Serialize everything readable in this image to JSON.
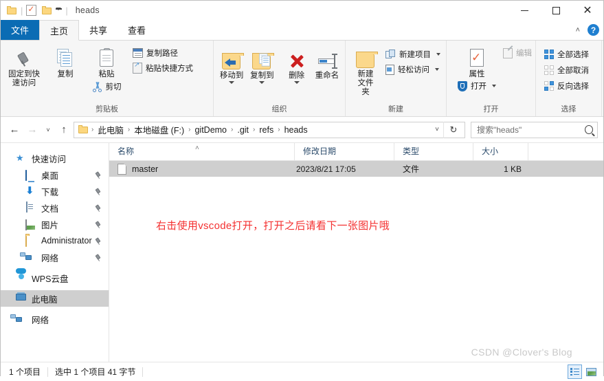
{
  "window": {
    "title": "heads",
    "quick_access": [
      "folder-icon",
      "properties-icon",
      "new-folder-icon"
    ],
    "controls": {
      "minimize": "—",
      "maximize": "□",
      "close": "✕"
    }
  },
  "tabs": [
    {
      "label": "文件",
      "type": "file"
    },
    {
      "label": "主页",
      "type": "active"
    },
    {
      "label": "共享",
      "type": "normal"
    },
    {
      "label": "查看",
      "type": "normal"
    }
  ],
  "tab_right": {
    "collapse": "˄",
    "help": "?"
  },
  "ribbon": {
    "groups": [
      {
        "label": "剪贴板",
        "big": [
          {
            "label": "固定到快\n速访问",
            "line1": "固定到快",
            "line2": "速访问",
            "icon": "pin-icon"
          },
          {
            "label": "复制",
            "line1": "复制",
            "line2": "",
            "icon": "copy-icon"
          },
          {
            "label": "粘贴",
            "line1": "粘贴",
            "line2": "",
            "icon": "paste-icon"
          }
        ],
        "small": [
          {
            "label": "复制路径",
            "icon": "copy-path-icon"
          },
          {
            "label": "粘贴快捷方式",
            "icon": "paste-shortcut-icon"
          }
        ],
        "cut": {
          "label": "剪切",
          "icon": "scissors-icon"
        }
      },
      {
        "label": "组织",
        "big": [
          {
            "line1": "移动到",
            "icon": "move-to-icon",
            "caret": true
          },
          {
            "line1": "复制到",
            "icon": "copy-to-icon",
            "caret": true
          },
          {
            "line1": "删除",
            "icon": "delete-icon",
            "caret": true
          },
          {
            "line1": "重命名",
            "icon": "rename-icon",
            "caret": false
          }
        ]
      },
      {
        "label": "新建",
        "big": [
          {
            "line1": "新建",
            "line2": "文件夹",
            "icon": "new-folder-icon"
          }
        ],
        "small": [
          {
            "label": "新建项目",
            "icon": "new-item-icon",
            "caret": true
          },
          {
            "label": "轻松访问",
            "icon": "easy-access-icon",
            "caret": true
          }
        ]
      },
      {
        "label": "打开",
        "big": [
          {
            "line1": "属性",
            "icon": "properties-icon"
          }
        ],
        "small": [
          {
            "label": "编辑",
            "icon": "edit-icon",
            "dim": true
          }
        ],
        "open": {
          "label": "打开",
          "icon": "shield-open-icon",
          "caret": true
        }
      },
      {
        "label": "选择",
        "small": [
          {
            "label": "全部选择",
            "icon": "select-all-icon"
          },
          {
            "label": "全部取消",
            "icon": "select-none-icon"
          },
          {
            "label": "反向选择",
            "icon": "invert-selection-icon"
          }
        ]
      }
    ]
  },
  "address": {
    "back": "←",
    "forward": "→",
    "recent": "˅",
    "up": "↑",
    "breadcrumbs": [
      "此电脑",
      "本地磁盘 (F:)",
      "gitDemo",
      ".git",
      "refs",
      "heads"
    ],
    "separator": "›",
    "dropdown": "˅",
    "refresh": "↻"
  },
  "search": {
    "placeholder": "搜索\"heads\"",
    "value": "",
    "icon": "search-icon"
  },
  "sidebar": {
    "items": [
      {
        "label": "快速访问",
        "icon": "star-icon",
        "child": false,
        "pin": false,
        "selected": false
      },
      {
        "label": "桌面",
        "icon": "desktop-icon",
        "child": true,
        "pin": true,
        "selected": false
      },
      {
        "label": "下载",
        "icon": "downloads-icon",
        "child": true,
        "pin": true,
        "selected": false
      },
      {
        "label": "文档",
        "icon": "documents-icon",
        "child": true,
        "pin": true,
        "selected": false
      },
      {
        "label": "图片",
        "icon": "pictures-icon",
        "child": true,
        "pin": true,
        "selected": false
      },
      {
        "label": "Administrator",
        "icon": "folder-icon",
        "child": true,
        "pin": true,
        "selected": false
      },
      {
        "label": "网络",
        "icon": "network-icon",
        "child": true,
        "pin": true,
        "selected": false
      },
      {
        "label": "WPS云盘",
        "icon": "cloud-icon",
        "child": false,
        "pin": false,
        "selected": false
      },
      {
        "label": "此电脑",
        "icon": "this-pc-icon",
        "child": false,
        "pin": false,
        "selected": true
      },
      {
        "label": "网络",
        "icon": "network-icon",
        "child": false,
        "pin": false,
        "selected": false
      }
    ]
  },
  "filelist": {
    "columns": [
      {
        "label": "名称",
        "sorted": true,
        "sort_glyph": "˄"
      },
      {
        "label": "修改日期",
        "sorted": false
      },
      {
        "label": "类型",
        "sorted": false
      },
      {
        "label": "大小",
        "sorted": false
      }
    ],
    "rows": [
      {
        "name": "master",
        "modified": "2023/8/21 17:05",
        "type": "文件",
        "size": "1 KB",
        "icon": "file-icon",
        "selected": true
      }
    ],
    "annotation": "右击使用vscode打开，打开之后请看下一张图片哦"
  },
  "status": {
    "item_count": "1 个项目",
    "selection": "选中 1 个项目  41 字节",
    "view_details": "details-view-icon",
    "view_large": "large-icons-view-icon"
  },
  "watermark": "CSDN @Clover's Blog",
  "colors": {
    "accent": "#0b6cb4",
    "selection": "#cfcfcf",
    "annotation_red": "#f43030",
    "ribbon_bg": "#f6f6f6",
    "column_header_text": "#2b4b6b"
  }
}
